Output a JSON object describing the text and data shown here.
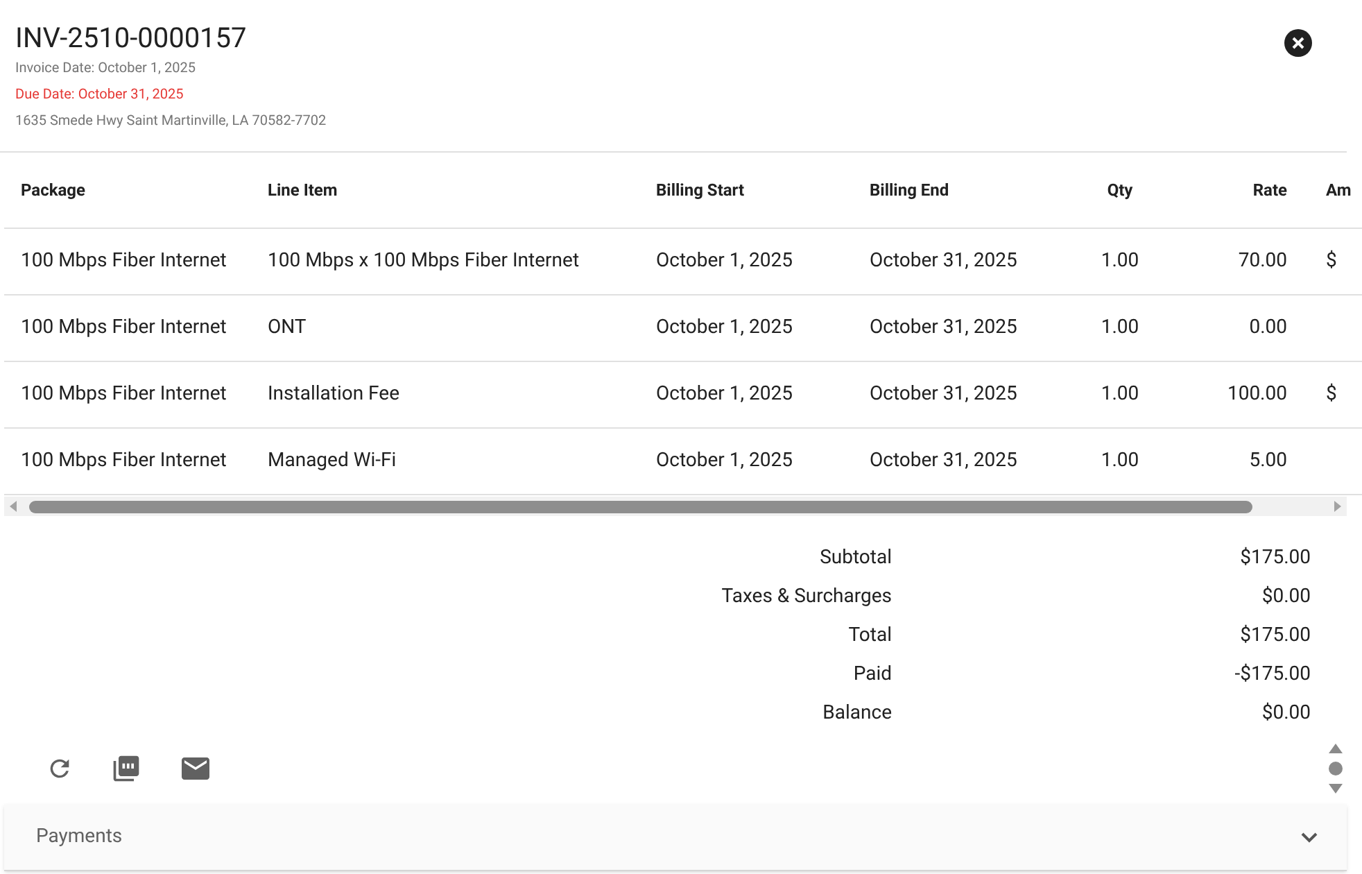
{
  "invoice": {
    "number": "INV-2510-0000157",
    "invoice_date": "Invoice Date: October 1, 2025",
    "due_date": "Due Date: October 31, 2025",
    "address": "1635 Smede Hwy Saint Martinville, LA 70582-7702"
  },
  "table": {
    "columns": [
      "Package",
      "Line Item",
      "Billing Start",
      "Billing End",
      "Qty",
      "Rate",
      "Am"
    ],
    "rows": [
      {
        "package": "100 Mbps Fiber Internet",
        "line_item": "100 Mbps x 100 Mbps Fiber Internet",
        "billing_start": "October 1, 2025",
        "billing_end": "October 31, 2025",
        "qty": "1.00",
        "rate": "70.00",
        "amount": "$"
      },
      {
        "package": "100 Mbps Fiber Internet",
        "line_item": "ONT",
        "billing_start": "October 1, 2025",
        "billing_end": "October 31, 2025",
        "qty": "1.00",
        "rate": "0.00"
      },
      {
        "package": "100 Mbps Fiber Internet",
        "line_item": "Installation Fee",
        "billing_start": "October 1, 2025",
        "billing_end": "October 31, 2025",
        "qty": "1.00",
        "rate": "100.00",
        "amount": "$"
      },
      {
        "package": "100 Mbps Fiber Internet",
        "line_item": "Managed Wi-Fi",
        "billing_start": "October 1, 2025",
        "billing_end": "October 31, 2025",
        "qty": "1.00",
        "rate": "5.00"
      }
    ]
  },
  "totals": [
    {
      "label": "Subtotal",
      "value": "$175.00"
    },
    {
      "label": "Taxes & Surcharges",
      "value": "$0.00"
    },
    {
      "label": "Total",
      "value": "$175.00"
    },
    {
      "label": "Paid",
      "value": "-$175.00"
    },
    {
      "label": "Balance",
      "value": "$0.00"
    }
  ],
  "payments": {
    "title": "Payments",
    "expanded": false
  }
}
